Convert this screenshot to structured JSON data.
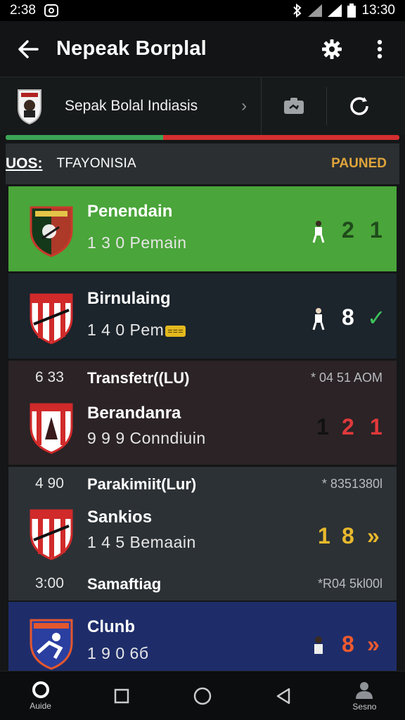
{
  "status_bar": {
    "time": "2:38",
    "clock": "13:30"
  },
  "app_bar": {
    "title": "Nepeak Borplal"
  },
  "league": {
    "name": "Sepak Bolal Indiasis",
    "progress_fraction": 0.4
  },
  "matchday": {
    "code": "UOS:",
    "name": "TFAYONISIA",
    "status": "PAUNED"
  },
  "matches": [
    {
      "team": "Penendain",
      "sub": "1 3 0 Pemain",
      "score_a": "2",
      "score_b": "1",
      "bg": "#4aa53a",
      "score_color": "#1f4a1b",
      "badge_colors": [
        "#1b3d1a",
        "#c8392b"
      ]
    },
    {
      "team": "Birnulaing",
      "sub": "1 4 0 Pem",
      "sub_badge": "===",
      "score_a": "8",
      "score_b": "✓",
      "bg": "#1c242c",
      "score_color": "#ffffff",
      "check_color": "#3fc259"
    },
    {
      "time": "6 33",
      "event": "Transfetr((LU)",
      "stamp": "* 04 51 AOM",
      "team": "Berandanra",
      "sub": "9 9 9 Conndiuin",
      "score_lead": "1",
      "score_a": "2",
      "score_b": "1",
      "bg": "#2b2326",
      "score_color": "#e0393b"
    },
    {
      "time": "4 90",
      "event": "Parakimiit(Lur)",
      "stamp": "* 8351380l",
      "team": "Sankios",
      "sub": "1 4 5 Bemaain",
      "score_a": "1",
      "score_b": "8",
      "score_c": "»",
      "bg": "#2c3135",
      "score_color": "#e8b92c"
    },
    {
      "time": "3:00",
      "event": "Samaftiag",
      "stamp": "*R04 5kl00l",
      "team": "Clunb",
      "sub": "1 9 0 6б",
      "score_a": "8",
      "score_b": "»",
      "bg": "#1e2d6a",
      "score_color": "#ee5a2f"
    }
  ],
  "nav": {
    "home_label": "Auide",
    "profile_label": "Sesno"
  },
  "colors": {
    "accent_green": "#3aa655",
    "accent_red": "#d32f2f",
    "paused": "#e0a43a"
  }
}
